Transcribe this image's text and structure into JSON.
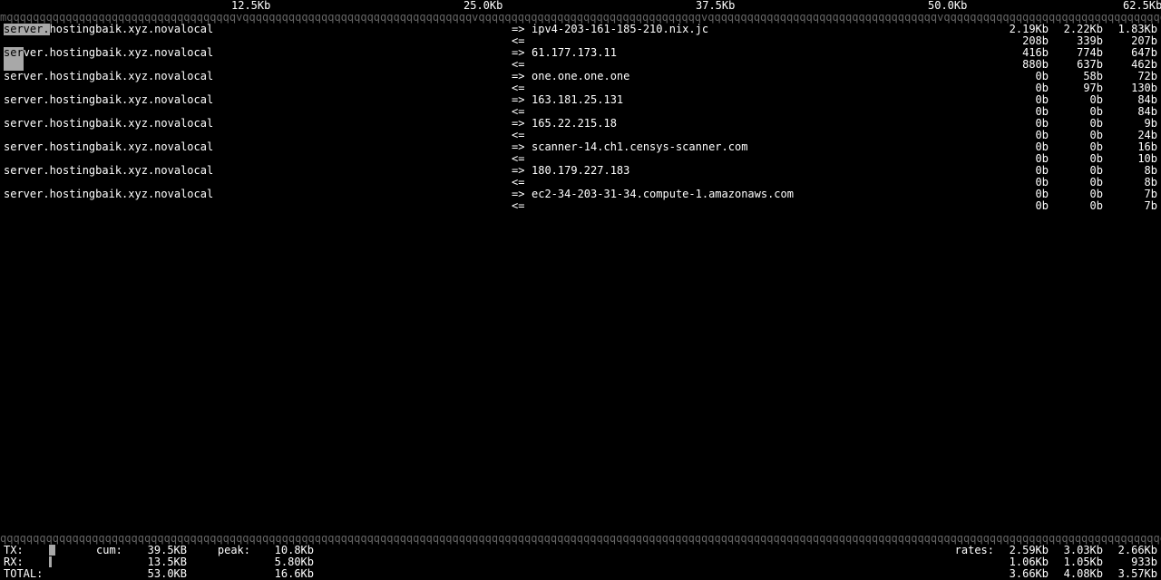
{
  "scale": {
    "t1": "12.5Kb",
    "t2": "25.0Kb",
    "t3": "37.5Kb",
    "t4": "50.0Kb",
    "t5": "62.5Kb"
  },
  "arrows": {
    "out": "=>",
    "in": "<="
  },
  "rows": [
    {
      "src": "server.hostingbaik.xyz.novalocal",
      "dst": "ipv4-203-161-185-210.nix.jc",
      "out": [
        "2.19Kb",
        "2.22Kb",
        "1.83Kb"
      ],
      "in": [
        "208b",
        "339b",
        "207b"
      ]
    },
    {
      "src": "server.hostingbaik.xyz.novalocal",
      "dst": "61.177.173.11",
      "out": [
        "416b",
        "774b",
        "647b"
      ],
      "in": [
        "880b",
        "637b",
        "462b"
      ]
    },
    {
      "src": "server.hostingbaik.xyz.novalocal",
      "dst": "one.one.one.one",
      "out": [
        "0b",
        "58b",
        "72b"
      ],
      "in": [
        "0b",
        "97b",
        "130b"
      ]
    },
    {
      "src": "server.hostingbaik.xyz.novalocal",
      "dst": "163.181.25.131",
      "out": [
        "0b",
        "0b",
        "84b"
      ],
      "in": [
        "0b",
        "0b",
        "84b"
      ]
    },
    {
      "src": "server.hostingbaik.xyz.novalocal",
      "dst": "165.22.215.18",
      "out": [
        "0b",
        "0b",
        "9b"
      ],
      "in": [
        "0b",
        "0b",
        "24b"
      ]
    },
    {
      "src": "server.hostingbaik.xyz.novalocal",
      "dst": "scanner-14.ch1.censys-scanner.com",
      "out": [
        "0b",
        "0b",
        "16b"
      ],
      "in": [
        "0b",
        "0b",
        "10b"
      ]
    },
    {
      "src": "server.hostingbaik.xyz.novalocal",
      "dst": "180.179.227.183",
      "out": [
        "0b",
        "0b",
        "8b"
      ],
      "in": [
        "0b",
        "0b",
        "8b"
      ]
    },
    {
      "src": "server.hostingbaik.xyz.novalocal",
      "dst": "ec2-34-203-31-34.compute-1.amazonaws.com",
      "out": [
        "0b",
        "0b",
        "7b"
      ],
      "in": [
        "0b",
        "0b",
        "7b"
      ]
    }
  ],
  "footer": {
    "cum_label": "cum:",
    "peak_label": "peak:",
    "rates_label": "rates:",
    "tx": {
      "label": "TX:",
      "cum": "39.5KB",
      "peak": "10.8Kb",
      "r": [
        "2.59Kb",
        "3.03Kb",
        "2.66Kb"
      ]
    },
    "rx": {
      "label": "RX:",
      "cum": "13.5KB",
      "peak": "5.80Kb",
      "r": [
        "1.06Kb",
        "1.05Kb",
        "933b"
      ]
    },
    "total": {
      "label": "TOTAL:",
      "cum": "53.0KB",
      "peak": "16.6Kb",
      "r": [
        "3.66Kb",
        "4.08Kb",
        "3.57Kb"
      ]
    }
  },
  "barchar": "q",
  "barmarks": {
    "m": "m",
    "v": "v"
  }
}
